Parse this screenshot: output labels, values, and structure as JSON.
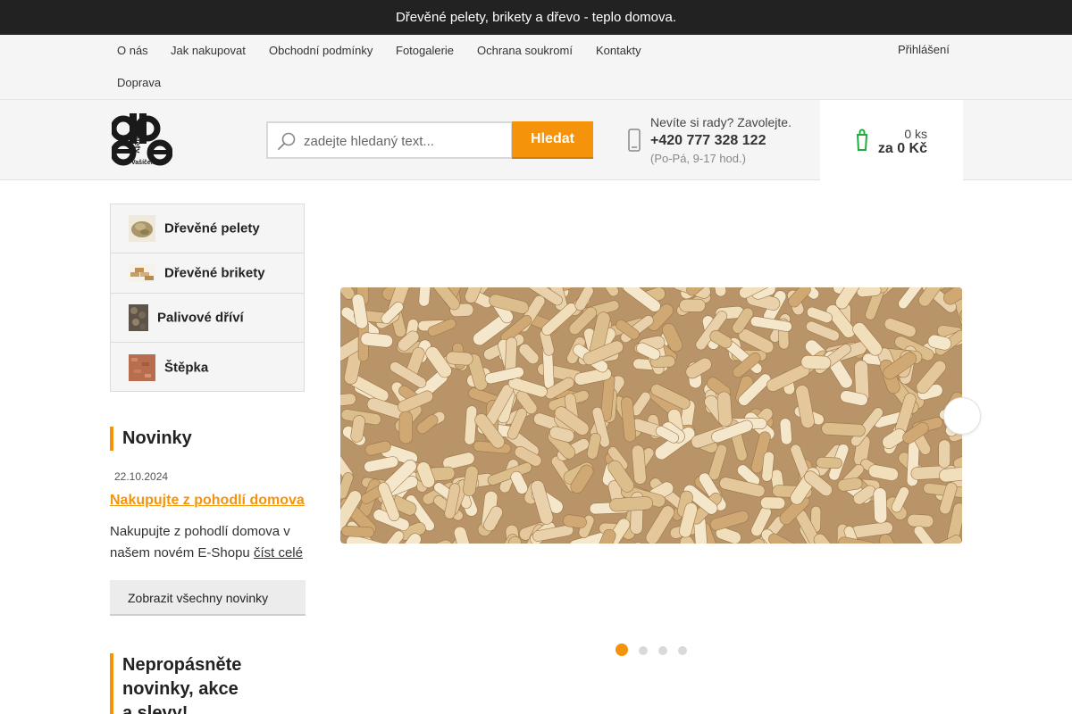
{
  "announcement": {
    "text": "Dřevěné pelety, brikety a dřevo - teplo domova.",
    "close_icon": ""
  },
  "topnav": [
    {
      "label": "O nás"
    },
    {
      "label": "Jak nakupovat"
    },
    {
      "label": "Obchodní podmínky"
    },
    {
      "label": "Fotogalerie"
    },
    {
      "label": "Ochrana soukromí"
    },
    {
      "label": "Kontakty"
    },
    {
      "label": "Doprava"
    }
  ],
  "login": {
    "icon": "",
    "label": "Přihlášení"
  },
  "logo": {
    "word": "Pelety",
    "owner": "Vašíček"
  },
  "search": {
    "placeholder": "zadejte hledaný text...",
    "button": "Hledat"
  },
  "help": {
    "phone_icon": "",
    "question": "Nevíte si rady? Zavolejte.",
    "phone": "+420 777 328 122",
    "hours": "(Po-Pá, 9-17 hod.)"
  },
  "cart": {
    "icon": "",
    "count": "0 ks",
    "total": "za 0 Kč"
  },
  "categories": [
    {
      "label": "Dřevěné pelety",
      "chevron": ""
    },
    {
      "label": "Dřevěné brikety",
      "chevron": ""
    },
    {
      "label": "Palivové dříví"
    },
    {
      "label": "Štěpka"
    }
  ],
  "news": {
    "title": "Novinky",
    "date_icon": "",
    "date": "22.10.2024",
    "item_title": "Nakupujte z pohodlí domova",
    "item_text": "Nakupujte z pohodlí domova v našem novém E-Shopu",
    "more": "číst celé",
    "all_button": "Zobrazit všechny novinky",
    "all_arrow": ""
  },
  "newsletter": {
    "title": "Nepropásněte novinky, akce a slevy!"
  },
  "slider": {
    "next_icon": "",
    "active_slide": 1,
    "slides_count": 4
  },
  "colors": {
    "accent": "#f5930b",
    "topbar": "#222222",
    "panel": "#f5f5f5"
  }
}
